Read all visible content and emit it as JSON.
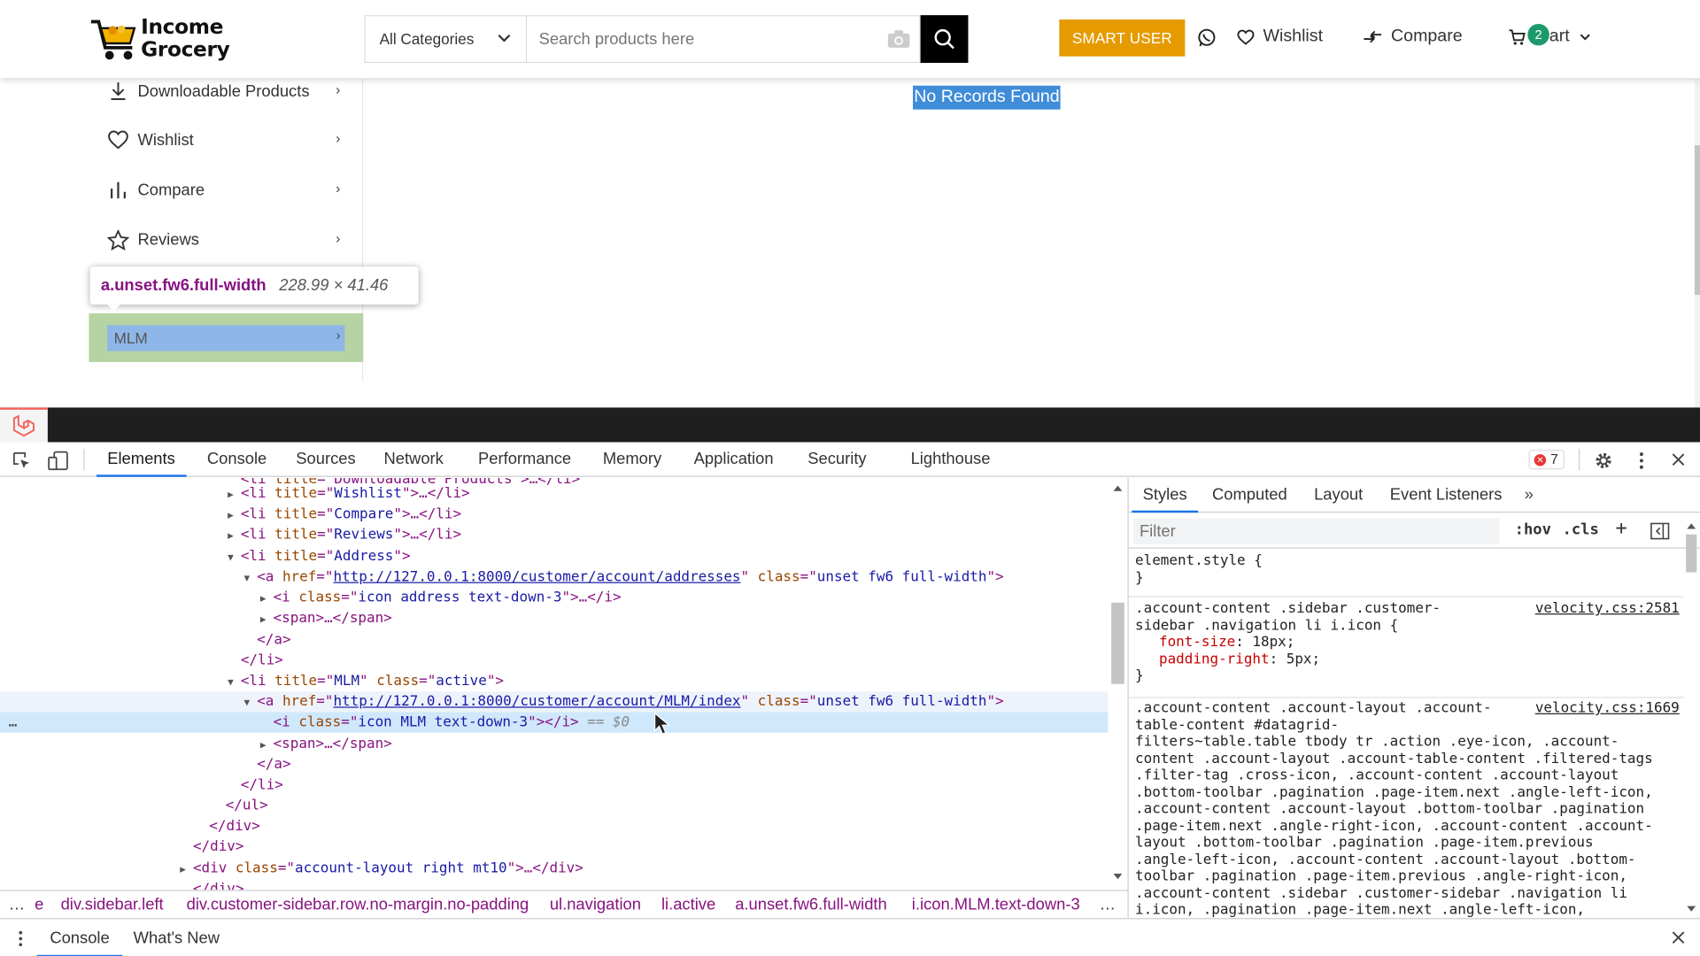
{
  "header": {
    "logo_line1": "Income",
    "logo_line2": "Grocery",
    "category_select": "All Categories",
    "search_placeholder": "Search products here",
    "smart_user_label": "SMART USER",
    "wishlist_label": "Wishlist",
    "compare_label": "Compare",
    "cart_label": "art",
    "cart_count": "2",
    "accent_color": "#e59a00"
  },
  "sidebar": {
    "items": [
      {
        "label": "Downloadable Products",
        "icon": "download-icon"
      },
      {
        "label": "Wishlist",
        "icon": "heart-icon"
      },
      {
        "label": "Compare",
        "icon": "bar-chart-icon"
      },
      {
        "label": "Reviews",
        "icon": "star-icon"
      }
    ],
    "mlm_label": "MLM",
    "arrow": "›"
  },
  "inspect_tooltip": {
    "selector": "a.unset.fw6.full-width",
    "dimensions": "228.99 × 41.46"
  },
  "main": {
    "no_records": "No Records Found"
  },
  "devtools": {
    "tabs": [
      "Elements",
      "Console",
      "Sources",
      "Network",
      "Performance",
      "Memory",
      "Application",
      "Security",
      "Lighthouse"
    ],
    "error_count": "7",
    "dom_lines": [
      {
        "pre": "<li ",
        "attr": "title",
        "val": "Wishlist",
        "post": ">…</li>"
      },
      {
        "pre": "<li ",
        "attr": "title",
        "val": "Compare",
        "post": ">…</li>"
      },
      {
        "pre": "<li ",
        "attr": "title",
        "val": "Reviews",
        "post": ">…</li>"
      },
      {
        "pre": "<li ",
        "attr": "title",
        "val": "Address",
        "post": ">"
      },
      {
        "href": "http://127.0.0.1:8000/customer/account/addresses",
        "cls": "unset fw6 full-width"
      },
      {
        "icls": "icon address text-down-3",
        "post": ">…</i>"
      },
      {
        "span": "<span>…</span>"
      },
      {
        "close": "</a>"
      },
      {
        "close": "</li>"
      },
      {
        "pre": "<li ",
        "attr": "title",
        "val": "MLM",
        "attr2": "class",
        "val2": "active",
        "post": ">"
      },
      {
        "href": "http://127.0.0.1:8000/customer/account/MLM/index",
        "cls": "unset fw6 full-width"
      },
      {
        "icls": "icon MLM text-down-3",
        "post": "></i>",
        "sel": "== $0"
      },
      {
        "span": "<span>…</span>"
      },
      {
        "close": "</a>"
      },
      {
        "close": "</li>"
      },
      {
        "close": "</ul>"
      },
      {
        "close": "</div>"
      },
      {
        "close": "</div>"
      },
      {
        "div": "account-layout right mt10",
        "post": ">…</div>"
      }
    ],
    "breadcrumbs": [
      "div.sidebar.left",
      "div.customer-sidebar.row.no-margin.no-padding",
      "ul.navigation",
      "li.active",
      "a.unset.fw6.full-width",
      "i.icon.MLM.text-down-3"
    ],
    "breadcrumb_first": "e",
    "styles_tabs": [
      "Styles",
      "Computed",
      "Layout",
      "Event Listeners"
    ],
    "filter_placeholder": "Filter",
    "hov_label": ":hov",
    "cls_label": ".cls",
    "element_style": "element.style {",
    "rule1": {
      "selector_lines": [
        ".account-content .sidebar .customer-",
        "sidebar .navigation li i.icon {"
      ],
      "source": "velocity.css:2581",
      "props": [
        [
          "font-size",
          "18px"
        ],
        [
          "padding-right",
          "5px"
        ]
      ]
    },
    "rule2": {
      "selector_lines": [
        ".account-content .account-layout .account-",
        "table-content #datagrid-",
        "filters~table.table tbody tr .action .eye-icon, .account-",
        "content .account-layout .account-table-content .filtered-tags",
        ".filter-tag .cross-icon, .account-content .account-layout",
        ".bottom-toolbar .pagination .page-item.next .angle-left-icon,",
        ".account-content .account-layout .bottom-toolbar .pagination",
        ".page-item.next .angle-right-icon, .account-content .account-",
        "layout .bottom-toolbar .pagination .page-item.previous",
        ".angle-left-icon, .account-content .account-layout .bottom-",
        "toolbar .pagination .page-item.previous .angle-right-icon,",
        ".account-content .sidebar .customer-sidebar .navigation li",
        "i.icon, .pagination .page-item.next .angle-left-icon,"
      ],
      "source": "velocity.css:1669"
    },
    "drawer_tabs": [
      "Console",
      "What's New"
    ]
  }
}
